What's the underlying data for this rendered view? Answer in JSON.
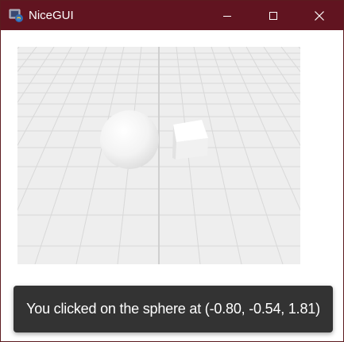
{
  "window": {
    "title": "NiceGUI",
    "titlebar_color": "#611420",
    "icons": {
      "app": "nicegui-app-icon",
      "minimize": "minimize-icon",
      "maximize": "maximize-icon",
      "close": "close-icon"
    }
  },
  "scene": {
    "background_color": "#eeeeee",
    "grid_color": "#d8d8d8",
    "objects": [
      "sphere",
      "box"
    ]
  },
  "notification": {
    "message": "You clicked on the sphere at (-0.80, -0.54, 1.81)",
    "background_color": "#333333"
  }
}
